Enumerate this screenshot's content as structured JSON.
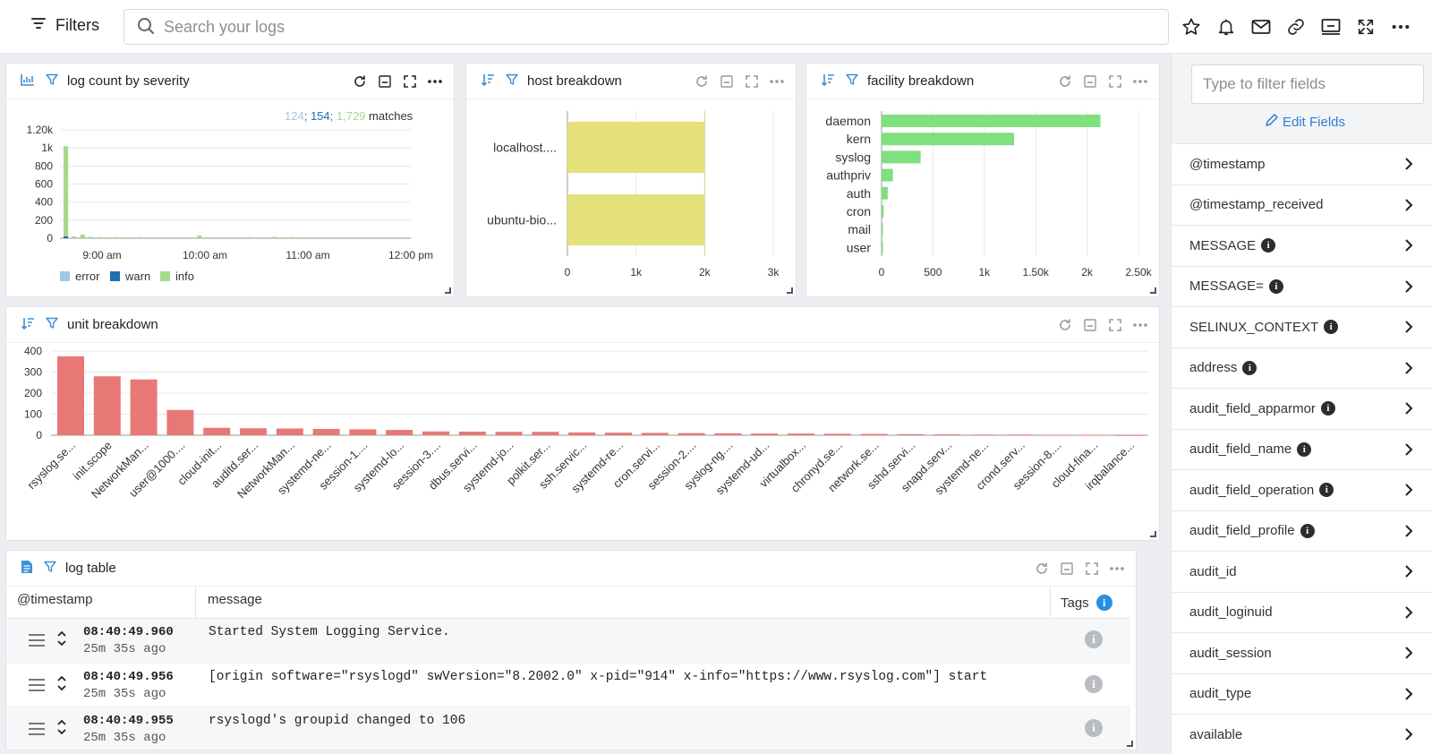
{
  "topbar": {
    "filters_label": "Filters",
    "search_placeholder": "Search your logs",
    "icons": [
      "star-icon",
      "alert-bell-icon",
      "mail-icon",
      "link-icon",
      "monitor-icon",
      "expand-icon",
      "more-icon"
    ]
  },
  "severity_panel": {
    "title": "log count by severity",
    "matches": {
      "error": "124",
      "warn": "154",
      "info": "1,729",
      "suffix": "matches"
    },
    "colors": {
      "error": "#9ec9e3",
      "warn": "#1f6fb2",
      "info": "#a6d98c"
    },
    "legend": [
      "error",
      "warn",
      "info"
    ]
  },
  "host_panel": {
    "title": "host breakdown"
  },
  "facility_panel": {
    "title": "facility breakdown"
  },
  "unit_panel": {
    "title": "unit breakdown"
  },
  "log_table": {
    "title": "log table",
    "columns": [
      "@timestamp",
      "message",
      "Tags"
    ],
    "rows": [
      {
        "timestamp": "08:40:49.960",
        "ago": "25m 35s ago",
        "message": "Started System Logging Service."
      },
      {
        "timestamp": "08:40:49.956",
        "ago": "25m 35s ago",
        "message": "[origin software=\"rsyslogd\" swVersion=\"8.2002.0\" x-pid=\"914\" x-info=\"https://www.rsyslog.com\"] start"
      },
      {
        "timestamp": "08:40:49.955",
        "ago": "25m 35s ago",
        "message": "rsyslogd's groupid changed to 106"
      }
    ]
  },
  "sidebar": {
    "filter_placeholder": "Type to filter fields",
    "edit_fields_label": "Edit Fields",
    "fields": [
      {
        "name": "@timestamp",
        "info": false
      },
      {
        "name": "@timestamp_received",
        "info": false
      },
      {
        "name": "MESSAGE",
        "info": true
      },
      {
        "name": "MESSAGE=",
        "info": true
      },
      {
        "name": "SELINUX_CONTEXT",
        "info": true
      },
      {
        "name": "address",
        "info": true
      },
      {
        "name": "audit_field_apparmor",
        "info": true
      },
      {
        "name": "audit_field_name",
        "info": true
      },
      {
        "name": "audit_field_operation",
        "info": true
      },
      {
        "name": "audit_field_profile",
        "info": true
      },
      {
        "name": "audit_id",
        "info": false
      },
      {
        "name": "audit_loginuid",
        "info": false
      },
      {
        "name": "audit_session",
        "info": false
      },
      {
        "name": "audit_type",
        "info": false
      },
      {
        "name": "available",
        "info": false
      }
    ]
  },
  "chart_data": [
    {
      "type": "bar",
      "title": "log count by severity",
      "x_ticks": [
        "9:00 am",
        "10:00 am",
        "11:00 am",
        "12:00 pm"
      ],
      "y_ticks": [
        "0",
        "200",
        "400",
        "600",
        "800",
        "1k",
        "1.20k"
      ],
      "ylim": [
        0,
        1200
      ],
      "legend": [
        "error",
        "warn",
        "info"
      ],
      "series": [
        {
          "name": "info",
          "values": [
            1000,
            20,
            40,
            15,
            12,
            10,
            12,
            10,
            10,
            12,
            10,
            10,
            10,
            10,
            10,
            10,
            30,
            10,
            10,
            10,
            10,
            10,
            12,
            10,
            10,
            15,
            10,
            12,
            10,
            10,
            10,
            10,
            10,
            10,
            10,
            10,
            10,
            10,
            10,
            10,
            10,
            10
          ]
        },
        {
          "name": "warn",
          "values": [
            20,
            0,
            0,
            0,
            0,
            0,
            0,
            0,
            0,
            0,
            0,
            0,
            0,
            0,
            0,
            0,
            0,
            0,
            0,
            0,
            0,
            0,
            0,
            0,
            0,
            0,
            0,
            0,
            0,
            0,
            0,
            0,
            0,
            0,
            0,
            0,
            0,
            0,
            0,
            0,
            0,
            0
          ]
        }
      ],
      "grid": true,
      "legend_position": "bottom-left"
    },
    {
      "type": "bar",
      "orientation": "horizontal",
      "title": "host breakdown",
      "categories": [
        "localhost....",
        "ubuntu-bio..."
      ],
      "values": [
        2000,
        2000
      ],
      "x_ticks": [
        "0",
        "1k",
        "2k",
        "3k"
      ],
      "xlim": [
        0,
        3000
      ],
      "color": "#e4e07a"
    },
    {
      "type": "bar",
      "orientation": "horizontal",
      "title": "facility breakdown",
      "categories": [
        "daemon",
        "kern",
        "syslog",
        "authpriv",
        "auth",
        "cron",
        "mail",
        "user"
      ],
      "values": [
        2130,
        1290,
        380,
        110,
        60,
        20,
        8,
        5
      ],
      "x_ticks": [
        "0",
        "500",
        "1k",
        "1.50k",
        "2k",
        "2.50k"
      ],
      "xlim": [
        0,
        2500
      ],
      "color": "#7ee07e"
    },
    {
      "type": "bar",
      "title": "unit breakdown",
      "categories": [
        "rsyslog.se...",
        "init.scope",
        "NetworkMan...",
        "user@1000....",
        "cloud-init...",
        "auditd.ser...",
        "NetworkMan...",
        "systemd-ne...",
        "session-1....",
        "systemd-lo...",
        "session-3....",
        "dbus.servi...",
        "systemd-jo...",
        "polkit.ser...",
        "ssh.servic...",
        "systemd-re...",
        "cron.servi...",
        "session-2....",
        "syslog-ng....",
        "systemd-ud...",
        "virtualbox...",
        "chronyd.se...",
        "network.se...",
        "sshd.servi...",
        "snapd.serv...",
        "systemd-ne...",
        "crond.serv...",
        "session-8....",
        "cloud-fina...",
        "irqbalance..."
      ],
      "values": [
        375,
        280,
        265,
        120,
        35,
        33,
        32,
        30,
        28,
        25,
        18,
        17,
        16,
        16,
        13,
        12,
        11,
        10,
        9,
        8,
        8,
        7,
        6,
        5,
        4,
        3,
        3,
        2,
        2,
        1
      ],
      "y_ticks": [
        "0",
        "100",
        "200",
        "300",
        "400"
      ],
      "ylim": [
        0,
        400
      ],
      "color": "#e87876"
    }
  ]
}
